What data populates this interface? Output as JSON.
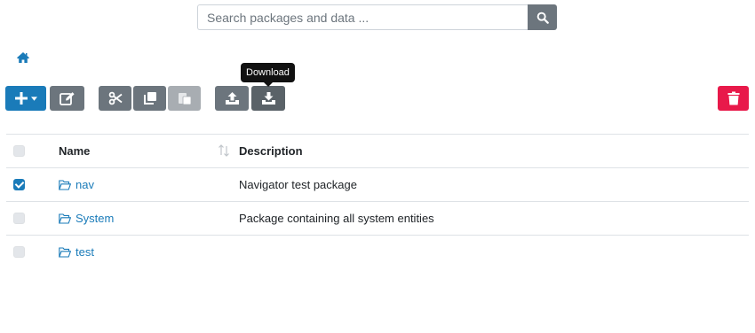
{
  "search": {
    "placeholder": "Search packages and data ...",
    "value": "",
    "button_icon": "search-icon"
  },
  "breadcrumb": {
    "home_icon": "home-icon"
  },
  "toolbar": {
    "add_icon": "plus-icon",
    "dropdown_icon": "caret-down-icon",
    "edit_icon": "edit-icon",
    "cut_icon": "scissors-icon",
    "copy_icon": "copy-icon",
    "paste_icon": "paste-icon",
    "upload_icon": "upload-icon",
    "download_icon": "download-icon",
    "delete_icon": "trash-icon",
    "tooltip": "Download"
  },
  "table": {
    "headers": {
      "name": "Name",
      "description": "Description"
    },
    "sort_icon": "sort-icon",
    "rows": [
      {
        "name": "nav",
        "description": "Navigator test package",
        "checked": true,
        "icon": "folder-open-icon"
      },
      {
        "name": "System",
        "description": "Package containing all system entities",
        "checked": false,
        "icon": "folder-open-icon"
      },
      {
        "name": "test",
        "description": "",
        "checked": false,
        "icon": "folder-open-icon"
      }
    ]
  },
  "colors": {
    "primary": "#1a7bb9",
    "secondary": "#6c757d",
    "danger": "#e8194a",
    "disabled": "#a8adb2"
  }
}
